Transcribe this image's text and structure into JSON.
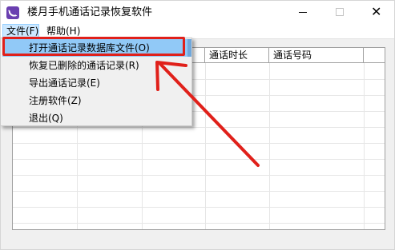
{
  "window": {
    "title": "楼月手机通话记录恢复软件",
    "close_glyph": "✕"
  },
  "icons": {
    "app": "phone-app-icon",
    "minimize": "minimize-icon",
    "maximize": "maximize-icon",
    "close": "close-icon",
    "annotation_arrow": "red-arrow"
  },
  "menubar": {
    "file": "文件(F)",
    "help": "帮助(H)"
  },
  "file_menu": {
    "items": [
      {
        "label": "打开通话记录数据库文件(O)"
      },
      {
        "label": "恢复已删除的通话记录(R)"
      },
      {
        "label": "导出通话记录(E)"
      },
      {
        "label": "注册软件(Z)"
      },
      {
        "label": "退出(Q)"
      }
    ]
  },
  "table": {
    "columns": [
      "通话时长",
      "通话号码"
    ]
  },
  "colors": {
    "annotation_red": "#e0201a",
    "selected_item": "#91c9f7",
    "menu_active": "#cce8ff",
    "app_icon": "#6a3fb0"
  }
}
